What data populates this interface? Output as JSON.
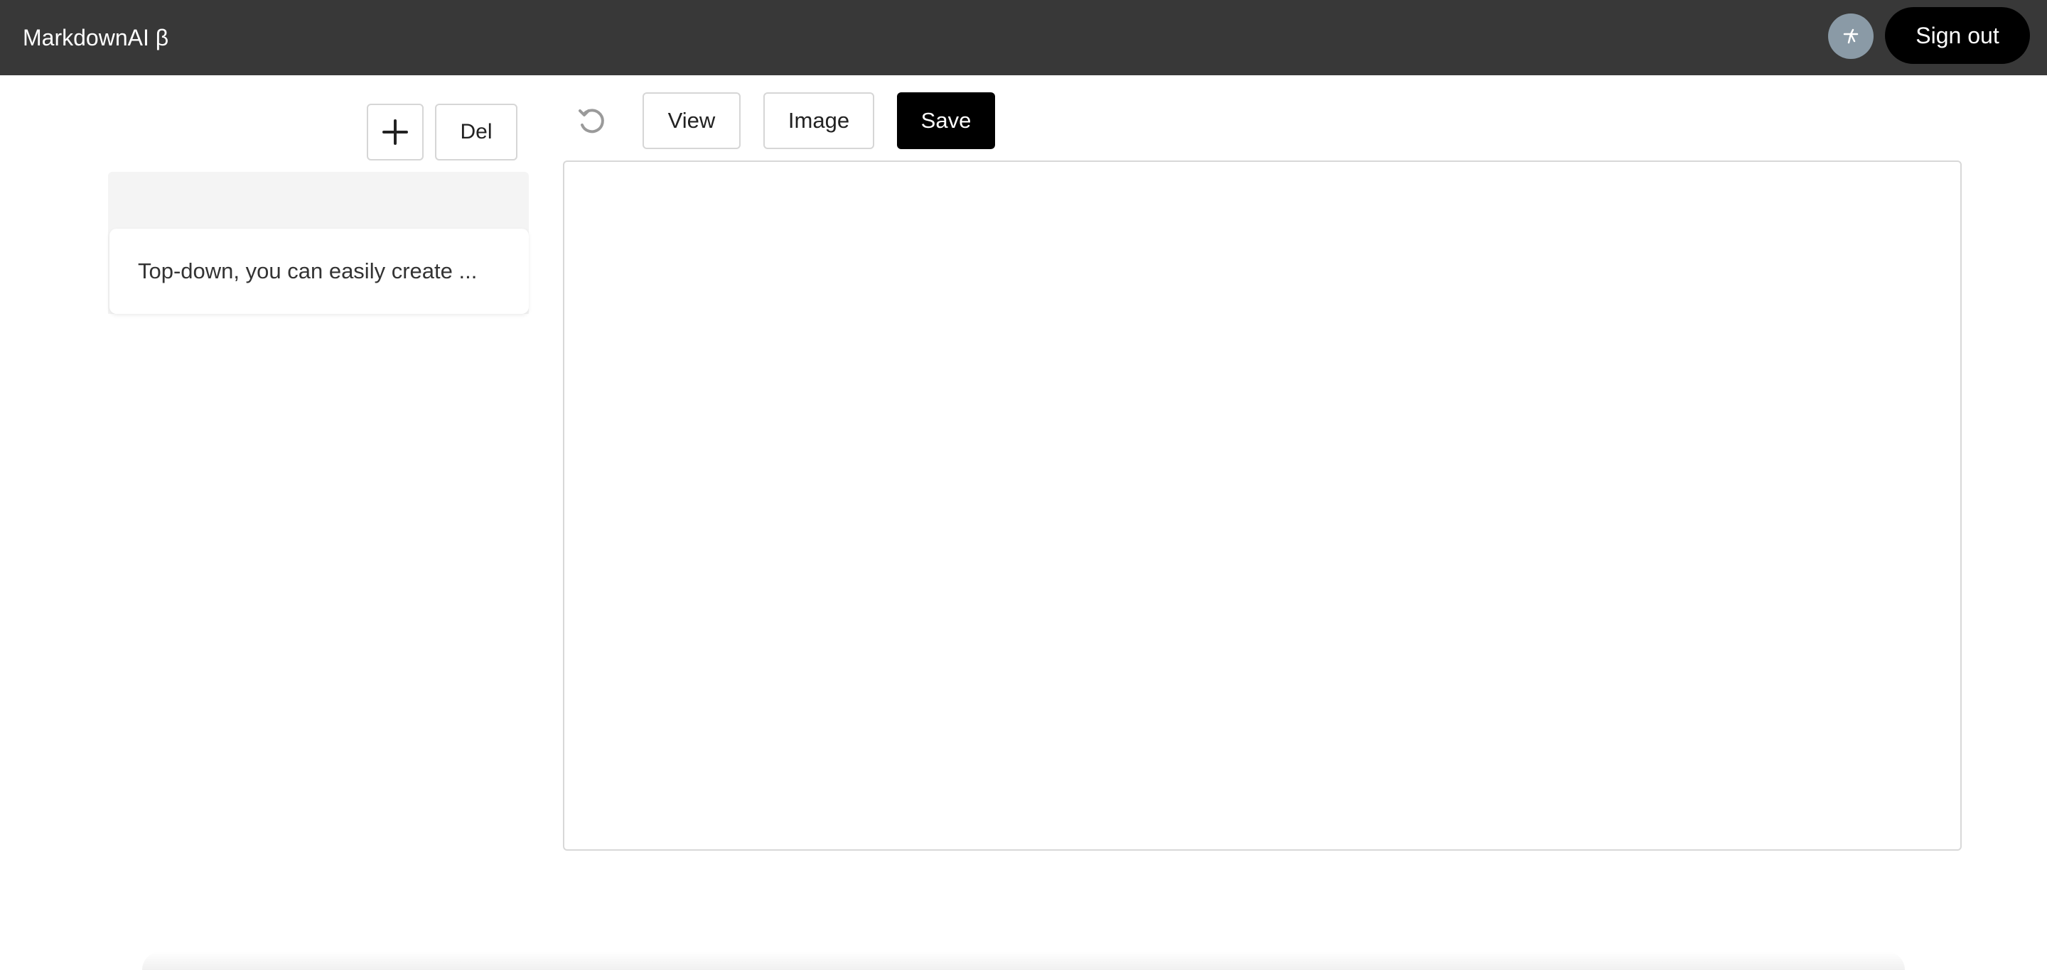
{
  "header": {
    "app_title": "MarkdownAI β",
    "avatar_icon": "user-avatar-icon",
    "sign_out_label": "Sign out",
    "background_color": "#383838"
  },
  "sidebar": {
    "add_icon": "plus-icon",
    "delete_label": "Del",
    "documents": [
      {
        "preview": "Top-down, you can easily create ..."
      }
    ]
  },
  "toolbar": {
    "undo_icon": "undo-icon",
    "view_label": "View",
    "image_label": "Image",
    "save_label": "Save"
  },
  "editor": {
    "value": "",
    "placeholder": ""
  }
}
